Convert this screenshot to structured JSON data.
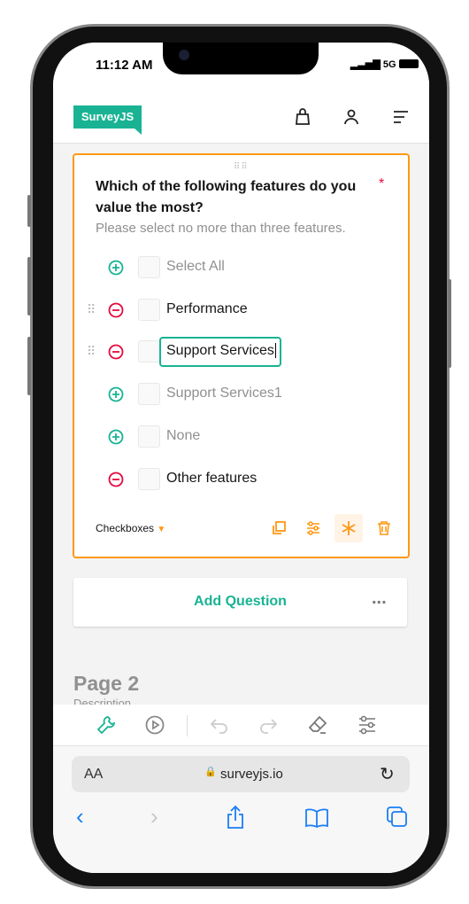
{
  "status": {
    "time": "11:12 AM",
    "network": "5G"
  },
  "header": {
    "logo": "SurveyJS",
    "icons": [
      "bag-icon",
      "user-icon",
      "menu-icon"
    ]
  },
  "question": {
    "title": "Which of the following features do you value the most?",
    "required": "*",
    "description": "Please select no more than three features.",
    "choices": [
      {
        "label": "Select All",
        "action": "add",
        "enabled": false,
        "draggable": false
      },
      {
        "label": "Performance",
        "action": "remove",
        "enabled": true,
        "draggable": true
      },
      {
        "label": "Support Services",
        "action": "remove",
        "enabled": true,
        "draggable": true,
        "editing": true
      },
      {
        "label": "Support Services1",
        "action": "add",
        "enabled": false,
        "draggable": false
      },
      {
        "label": "None",
        "action": "add",
        "enabled": false,
        "draggable": false
      },
      {
        "label": "Other features",
        "action": "remove",
        "enabled": true,
        "draggable": false
      }
    ],
    "type": "Checkboxes",
    "actions": [
      "duplicate-icon",
      "settings-icon",
      "required-icon",
      "delete-icon"
    ]
  },
  "add_question": {
    "label": "Add Question",
    "more": "..."
  },
  "page2": {
    "title": "Page 2",
    "description": "Description"
  },
  "toolbar": {
    "icons": [
      "designer-icon",
      "preview-icon",
      "undo-icon",
      "redo-icon",
      "clear-icon",
      "settings-icon"
    ]
  },
  "safari": {
    "aa": "AA",
    "url": "surveyjs.io"
  },
  "colors": {
    "accent": "#19b394",
    "selection": "#ff9814",
    "danger": "#e50a3e",
    "ios_blue": "#1a7ef5"
  }
}
